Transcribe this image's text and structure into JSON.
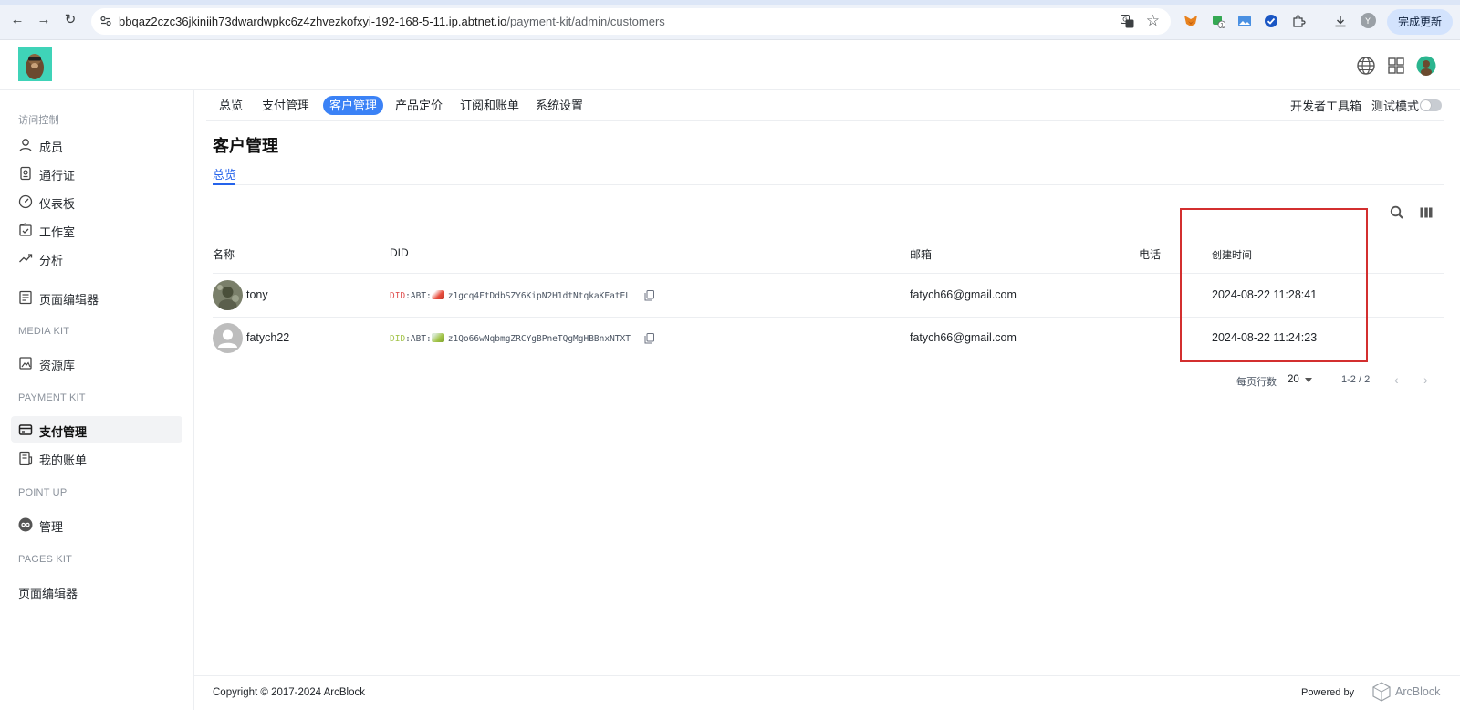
{
  "browser": {
    "url_host": "bbqaz2czc36jkiniih73dwardwpkc6z4zhvezkofxyi-192-168-5-11.ip.abtnet.io",
    "url_path": "/payment-kit/admin/customers",
    "update_button": "完成更新",
    "profile_initial": "Y",
    "extension_badge": "1"
  },
  "sidebar": {
    "section_access": "访问控制",
    "access_items": [
      {
        "label": "成员",
        "icon": "user-icon"
      },
      {
        "label": "通行证",
        "icon": "passport-icon"
      },
      {
        "label": "仪表板",
        "icon": "dashboard-icon"
      },
      {
        "label": "工作室",
        "icon": "studio-icon"
      },
      {
        "label": "分析",
        "icon": "analytics-icon"
      }
    ],
    "page_editor": "页面编辑器",
    "section_media": "MEDIA KIT",
    "media_items": [
      {
        "label": "资源库",
        "icon": "image-library-icon"
      }
    ],
    "section_payment": "PAYMENT KIT",
    "payment_items": [
      {
        "label": "支付管理",
        "icon": "card-icon",
        "active": true
      },
      {
        "label": "我的账单",
        "icon": "bill-icon"
      }
    ],
    "section_point": "POINT UP",
    "point_items": [
      {
        "label": "管理",
        "icon": "infinity-icon"
      }
    ],
    "section_pages": "PAGES KIT",
    "pages_items": [
      {
        "label": "页面编辑器"
      }
    ]
  },
  "topnav": {
    "tabs": [
      "总览",
      "支付管理",
      "客户管理",
      "产品定价",
      "订阅和账单",
      "系统设置"
    ],
    "active_tab": "客户管理",
    "dev_tools": "开发者工具箱",
    "test_mode": "测试模式"
  },
  "page": {
    "title": "客户管理",
    "subtab": "总览"
  },
  "table": {
    "columns": [
      "名称",
      "DID",
      "邮箱",
      "电话",
      "创建时间"
    ],
    "rows": [
      {
        "name": "tony",
        "did_prefix": "DID",
        "did_mid": ":ABT:",
        "did_value": "z1gcq4FtDdbSZY6KipN2H1dtNtqkaKEatEL",
        "email": "fatych66@gmail.com",
        "phone": "",
        "created": "2024-08-22 11:28:41"
      },
      {
        "name": "fatych22",
        "did_prefix": "DID",
        "did_mid": ":ABT:",
        "did_value": "z1Qo66wNqbmgZRCYgBPneTQgMgHBBnxNTXT",
        "email": "fatych66@gmail.com",
        "phone": "",
        "created": "2024-08-22 11:24:23"
      }
    ],
    "rows_per_page_label": "每页行数",
    "rows_per_page": "20",
    "range": "1-2 / 2"
  },
  "footer": {
    "copyright": "Copyright © 2017-2024  ArcBlock",
    "powered_by": "Powered by",
    "brand": "ArcBlock"
  },
  "colors": {
    "accent": "#3b82f6",
    "highlight_box": "#d32f2f",
    "did_red": "#e05252",
    "did_green": "#a3c44a"
  }
}
